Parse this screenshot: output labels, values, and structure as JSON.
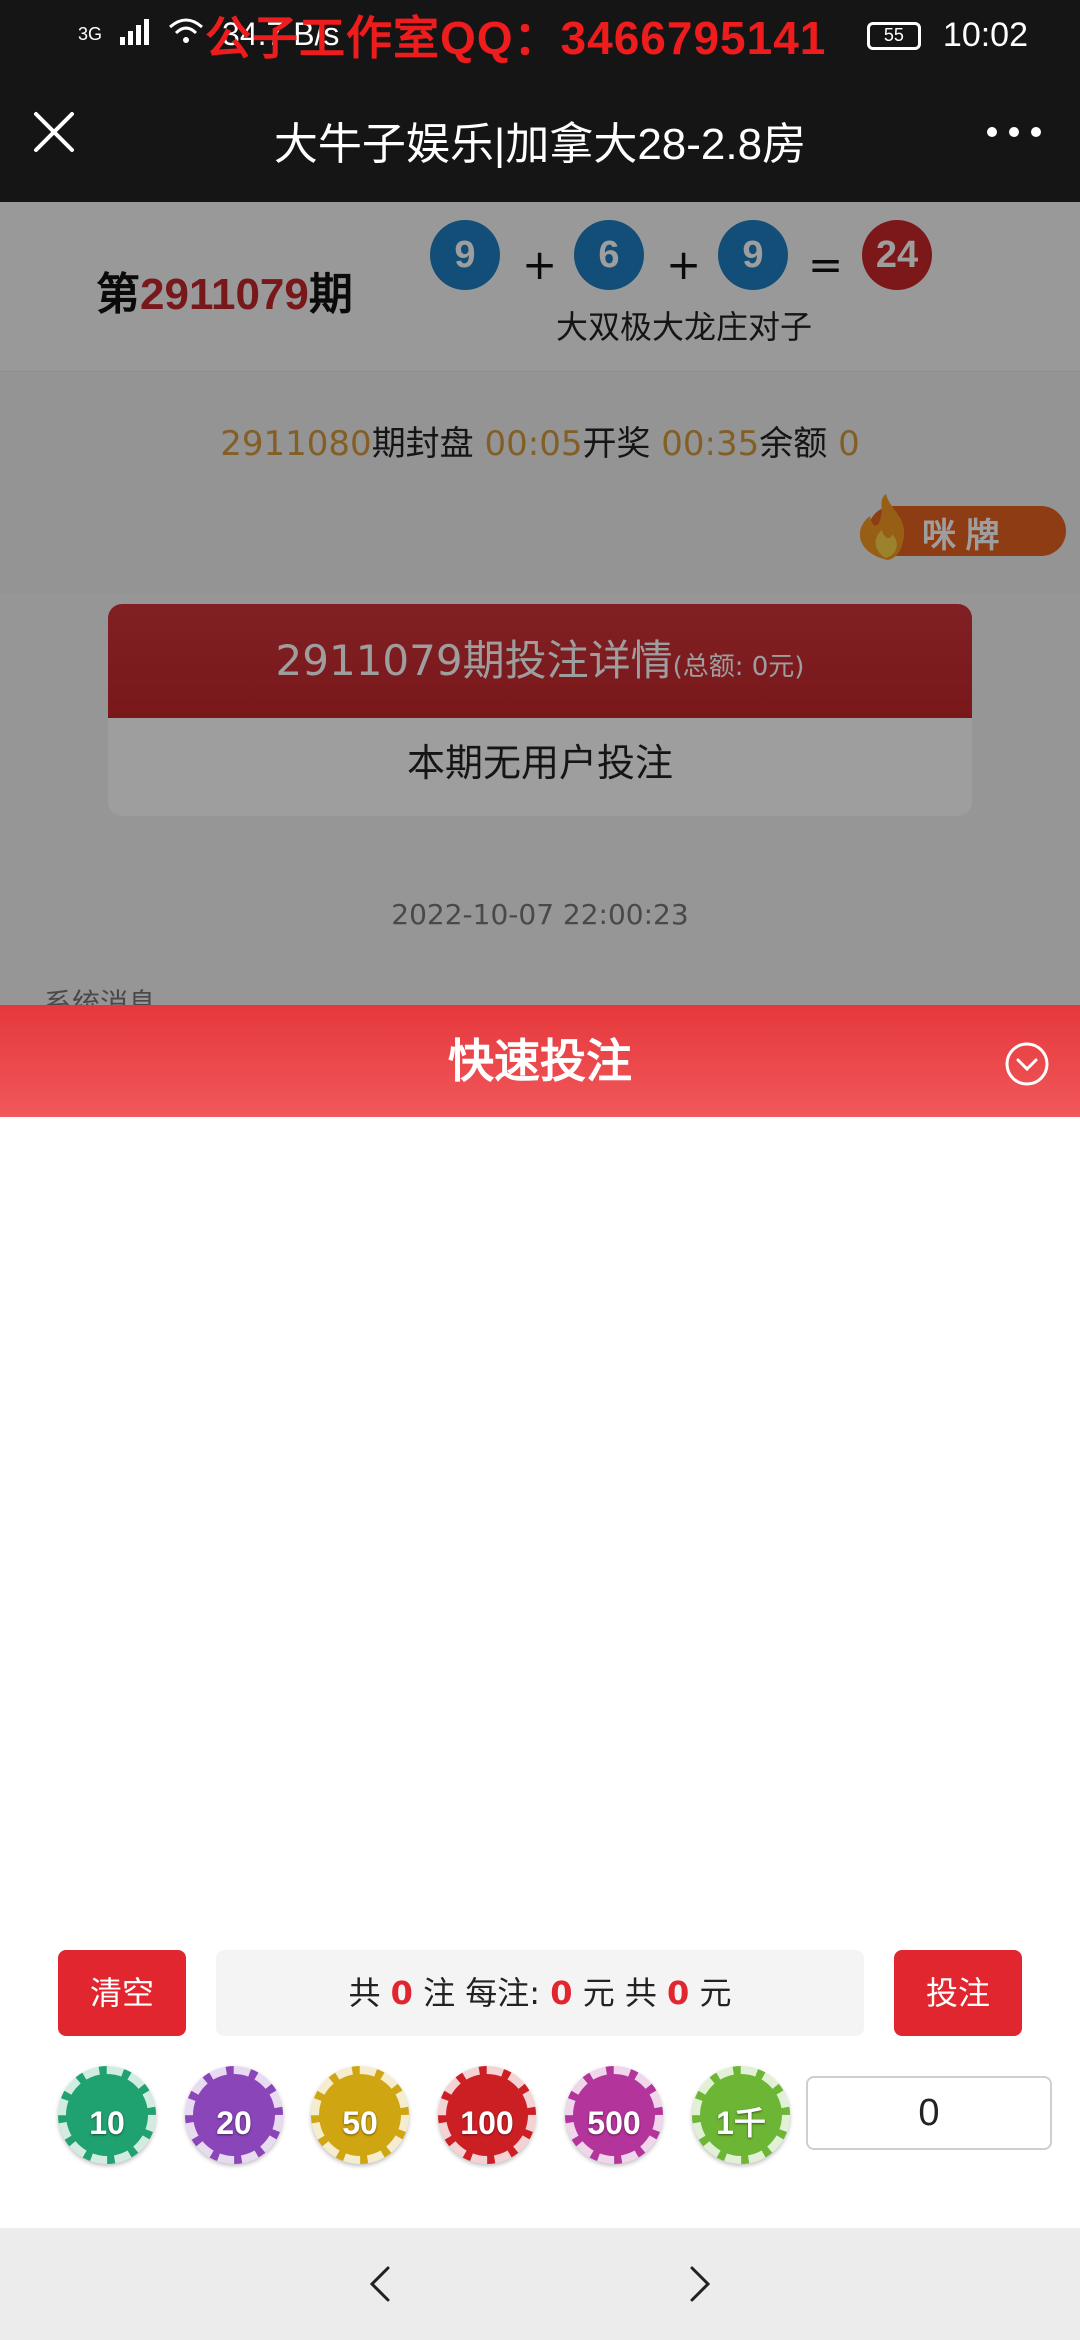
{
  "status_bar": {
    "network": "3G",
    "speed": "34.7 B/s",
    "time": "10:02",
    "battery": "55",
    "watermark": "公子工作室QQ：3466795141"
  },
  "titlebar": {
    "title": "大牛子娱乐|加拿大28-2.8房"
  },
  "draw": {
    "prefix": "第",
    "period": "2911079",
    "suffix": "期",
    "balls": [
      "9",
      "6",
      "9"
    ],
    "plus": "+",
    "equals": "=",
    "sum": "24",
    "result_text": "大双极大龙庄对子"
  },
  "countdown": {
    "next_period": "2911080",
    "close_label": "期封盘",
    "close_time": "00:05",
    "open_label": "开奖",
    "open_time": "00:35",
    "balance_label": "余额",
    "balance": "0",
    "peek_label": "咪 牌"
  },
  "bet_detail": {
    "period_title": "2911079期投注详情",
    "total": "(总额: 0元)",
    "empty_msg": "本期无用户投注"
  },
  "timestamp": "2022-10-07 22:00:23",
  "system_msg": "系统消息",
  "quick_bet": {
    "title": "快速投注",
    "clear_label": "清空",
    "bet_label": "投注",
    "summary": {
      "p1": "共",
      "count": "0",
      "p2": "注 每注:",
      "each": "0",
      "p3": "元 共",
      "total": "0",
      "p4": "元"
    },
    "chips": [
      "10",
      "20",
      "50",
      "100",
      "500",
      "1千"
    ],
    "amount_value": "0"
  },
  "colors": {
    "accent_red": "#e1262f",
    "header_dark": "#151515",
    "ball_blue": "#1e7fc2",
    "highlight_gold": "#d39a3e"
  }
}
